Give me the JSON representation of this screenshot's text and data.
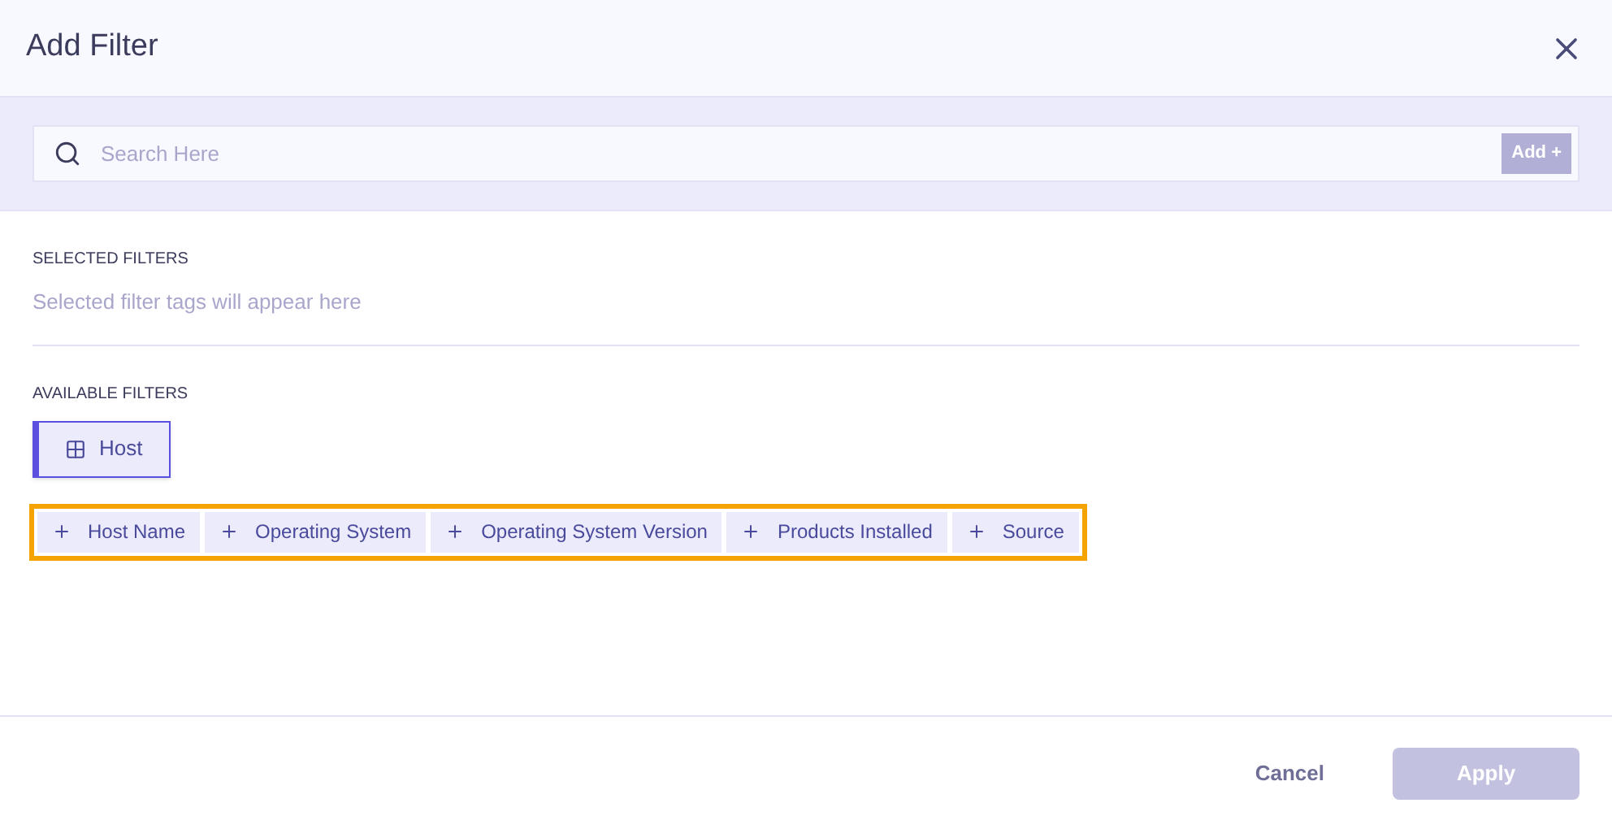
{
  "dialog": {
    "title": "Add Filter"
  },
  "search": {
    "placeholder": "Search Here",
    "add_button": {
      "label": "Add +",
      "disabled": true
    }
  },
  "selected_filters": {
    "heading": "SELECTED FILTERS",
    "empty_text": "Selected filter tags will appear here"
  },
  "available_filters": {
    "heading": "AVAILABLE FILTERS",
    "categories": [
      {
        "label": "Host",
        "selected": true
      }
    ],
    "fields_highlighted": true,
    "fields": [
      {
        "label": "Host Name"
      },
      {
        "label": "Operating System"
      },
      {
        "label": "Operating System Version"
      },
      {
        "label": "Products Installed"
      },
      {
        "label": "Source"
      }
    ]
  },
  "footer": {
    "cancel": "Cancel",
    "apply": {
      "label": "Apply",
      "disabled": true
    }
  }
}
